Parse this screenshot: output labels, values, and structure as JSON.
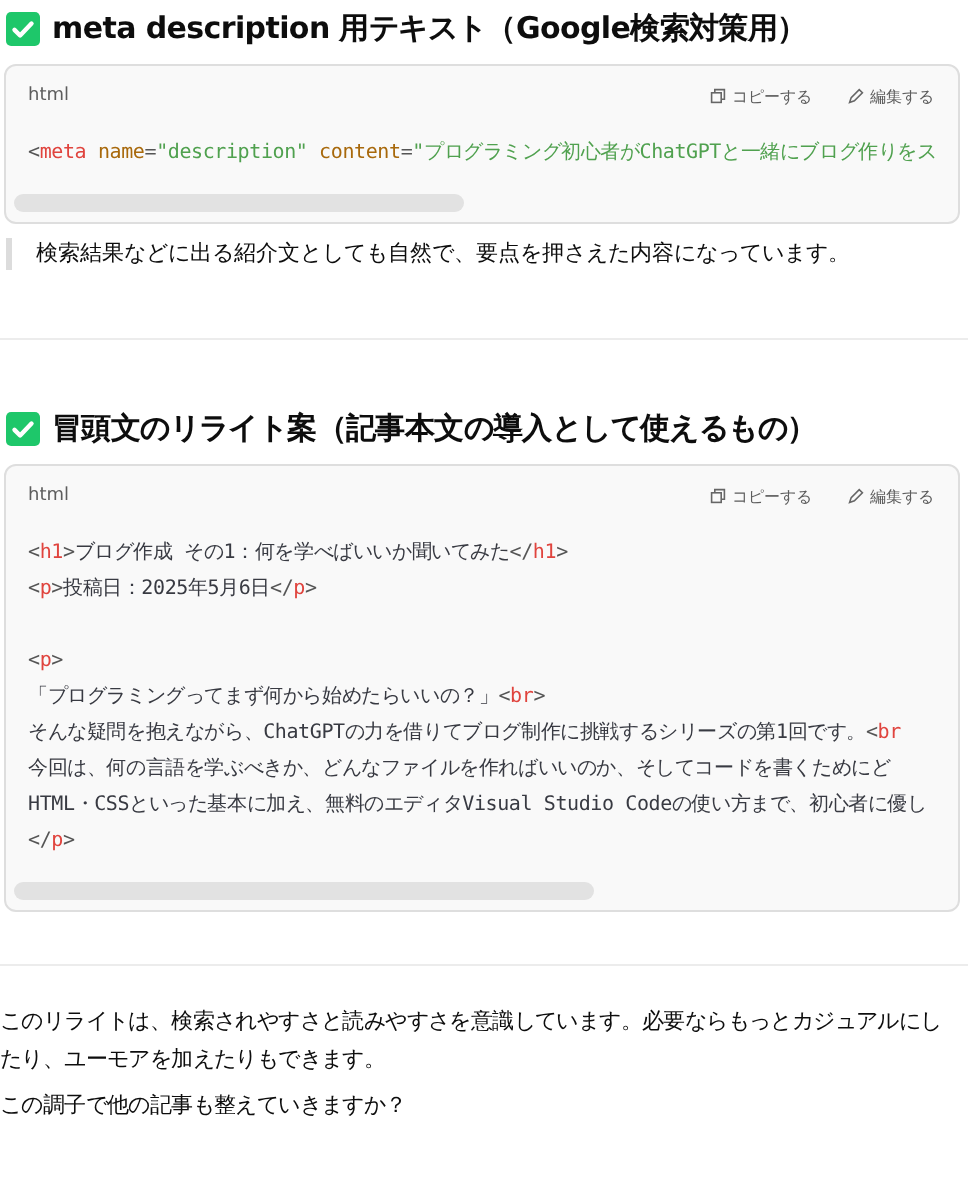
{
  "sections": [
    {
      "heading": "meta description 用テキスト（Google検索対策用）",
      "code": {
        "language": "html",
        "copy_label": "コピーする",
        "edit_label": "編集する",
        "lines": [
          {
            "kind": "code",
            "tokens": [
              {
                "kind": "punct",
                "text": "<"
              },
              {
                "kind": "tag",
                "text": "meta"
              },
              {
                "kind": "attr",
                "text": " name"
              },
              {
                "kind": "punct",
                "text": "="
              },
              {
                "kind": "string",
                "text": "\"description\""
              },
              {
                "kind": "attr",
                "text": " content"
              },
              {
                "kind": "punct",
                "text": "="
              },
              {
                "kind": "string",
                "text": "\"プログラミング初心者がChatGPTと一緒にブログ作りをス"
              }
            ]
          }
        ]
      },
      "note": "検索結果などに出る紹介文としても自然で、要点を押さえた内容になっています。"
    },
    {
      "heading": "冒頭文のリライト案（記事本文の導入として使えるもの）",
      "code": {
        "language": "html",
        "copy_label": "コピーする",
        "edit_label": "編集する",
        "lines": [
          {
            "kind": "code",
            "tokens": [
              {
                "kind": "punct",
                "text": "<"
              },
              {
                "kind": "tag",
                "text": "h1"
              },
              {
                "kind": "punct",
                "text": ">"
              },
              {
                "kind": "text",
                "text": "ブログ作成 その1：何を学べばいいか聞いてみた"
              },
              {
                "kind": "punct",
                "text": "</"
              },
              {
                "kind": "tag",
                "text": "h1"
              },
              {
                "kind": "punct",
                "text": ">"
              }
            ]
          },
          {
            "kind": "code",
            "tokens": [
              {
                "kind": "punct",
                "text": "<"
              },
              {
                "kind": "tag",
                "text": "p"
              },
              {
                "kind": "punct",
                "text": ">"
              },
              {
                "kind": "text",
                "text": "投稿日：2025年5月6日"
              },
              {
                "kind": "punct",
                "text": "</"
              },
              {
                "kind": "tag",
                "text": "p"
              },
              {
                "kind": "punct",
                "text": ">"
              }
            ]
          },
          {
            "kind": "blank"
          },
          {
            "kind": "code",
            "tokens": [
              {
                "kind": "punct",
                "text": "<"
              },
              {
                "kind": "tag",
                "text": "p"
              },
              {
                "kind": "punct",
                "text": ">"
              }
            ]
          },
          {
            "kind": "code",
            "tokens": [
              {
                "kind": "text",
                "text": "「プログラミングってまず何から始めたらいいの？」"
              },
              {
                "kind": "punct",
                "text": "<"
              },
              {
                "kind": "tag",
                "text": "br"
              },
              {
                "kind": "punct",
                "text": ">"
              }
            ]
          },
          {
            "kind": "code",
            "tokens": [
              {
                "kind": "text",
                "text": "そんな疑問を抱えながら、ChatGPTの力を借りてブログ制作に挑戦するシリーズの第1回です。"
              },
              {
                "kind": "punct",
                "text": "<"
              },
              {
                "kind": "tag",
                "text": "br"
              }
            ]
          },
          {
            "kind": "code",
            "tokens": [
              {
                "kind": "text",
                "text": "今回は、何の言語を学ぶべきか、どんなファイルを作ればいいのか、そしてコードを書くためにど"
              }
            ]
          },
          {
            "kind": "code",
            "tokens": [
              {
                "kind": "text",
                "text": "HTML・CSSといった基本に加え、無料のエディタVisual Studio Codeの使い方まで、初心者に優し"
              }
            ]
          },
          {
            "kind": "code",
            "tokens": [
              {
                "kind": "punct",
                "text": "</"
              },
              {
                "kind": "tag",
                "text": "p"
              },
              {
                "kind": "punct",
                "text": ">"
              }
            ]
          }
        ]
      }
    }
  ],
  "closing": [
    "このリライトは、検索されやすさと読みやすさを意識しています。必要ならもっとカジュアルにしたり、ユーモアを加えたりもできます。",
    "この調子で他の記事も整えていきますか？"
  ]
}
